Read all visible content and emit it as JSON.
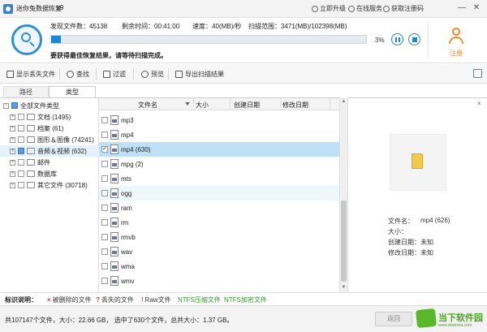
{
  "titlebar": {
    "title": "迷你兔数据恢复",
    "version": "v9",
    "links": [
      "立即升级",
      "在线服务",
      "获取注册码"
    ],
    "min": "—",
    "close": "✕"
  },
  "scan": {
    "found_label": "发现文件数：",
    "found_value": "45138",
    "remaining_label": "剩余时间：",
    "remaining_value": "00:41:00",
    "speed_label": "速度：",
    "speed_value": "40(MB)/秒",
    "range_label": "扫描范围：",
    "range_value": "3471(MB)/102398(MB)",
    "progress_percent": 3,
    "progress_text": "3%",
    "hint": "要获得最佳恢复结果，请等待扫描完成。",
    "register_label": "注册"
  },
  "toolbar": {
    "items": [
      "显示丢失文件",
      "查找",
      "过滤",
      "预览",
      "导出扫描结果"
    ]
  },
  "tabs": [
    "路径",
    "类型"
  ],
  "tree": {
    "root": "全部文件类型",
    "items": [
      {
        "label": "文档 (1495)"
      },
      {
        "label": "档案 (61)"
      },
      {
        "label": "图形＆图像 (74241)"
      },
      {
        "label": "音频＆视频 (632)"
      },
      {
        "label": "邮件"
      },
      {
        "label": "数据库"
      },
      {
        "label": "其它文件 (30718)"
      }
    ]
  },
  "file_list": {
    "columns": [
      "文件名",
      "大小",
      "创建日期",
      "修改日期"
    ],
    "rows": [
      {
        "name": "mp3",
        "checked": false
      },
      {
        "name": "mp4",
        "checked": false
      },
      {
        "name": "mp4 (630)",
        "checked": true
      },
      {
        "name": "mpg (2)",
        "checked": false
      },
      {
        "name": "mts",
        "checked": false
      },
      {
        "name": "ogg",
        "checked": false
      },
      {
        "name": "ram",
        "checked": false
      },
      {
        "name": "rm",
        "checked": false
      },
      {
        "name": "rmvb",
        "checked": false
      },
      {
        "name": "wav",
        "checked": false
      },
      {
        "name": "wma",
        "checked": false
      },
      {
        "name": "wmv",
        "checked": false
      }
    ]
  },
  "preview": {
    "close": "×",
    "filename_label": "文件名：",
    "filename_value": "mp4 (626)",
    "size_label": "大小：",
    "size_value": "",
    "created_label": "创建日期：",
    "created_value": "未知",
    "modified_label": "修改日期：",
    "modified_value": "未知"
  },
  "legend": {
    "title": "标识说明：",
    "items": [
      {
        "mark": "×",
        "label": "被删除的文件",
        "color": "#333333"
      },
      {
        "mark": "?",
        "label": "丢失的文件",
        "color": "#333333"
      },
      {
        "mark": "!",
        "label": "Raw文件",
        "color": "#333333"
      },
      {
        "mark": "",
        "label": "NTFS压缩文件",
        "color": "#2a9a2a"
      },
      {
        "mark": "",
        "label": "NTFS加密文件",
        "color": "#2a9a2a"
      }
    ]
  },
  "status": {
    "text": "共107147个文件，大小：22.66 GB，  选中了630个文件，总共大小：1.37 GB。",
    "back_label": "返回"
  },
  "watermark": {
    "text": "当下软件园",
    "sub": "www.downxia.com"
  },
  "colors": {
    "accent": "#1a88d6",
    "register": "#f08a24",
    "selected_row": "#bfe1f7"
  }
}
